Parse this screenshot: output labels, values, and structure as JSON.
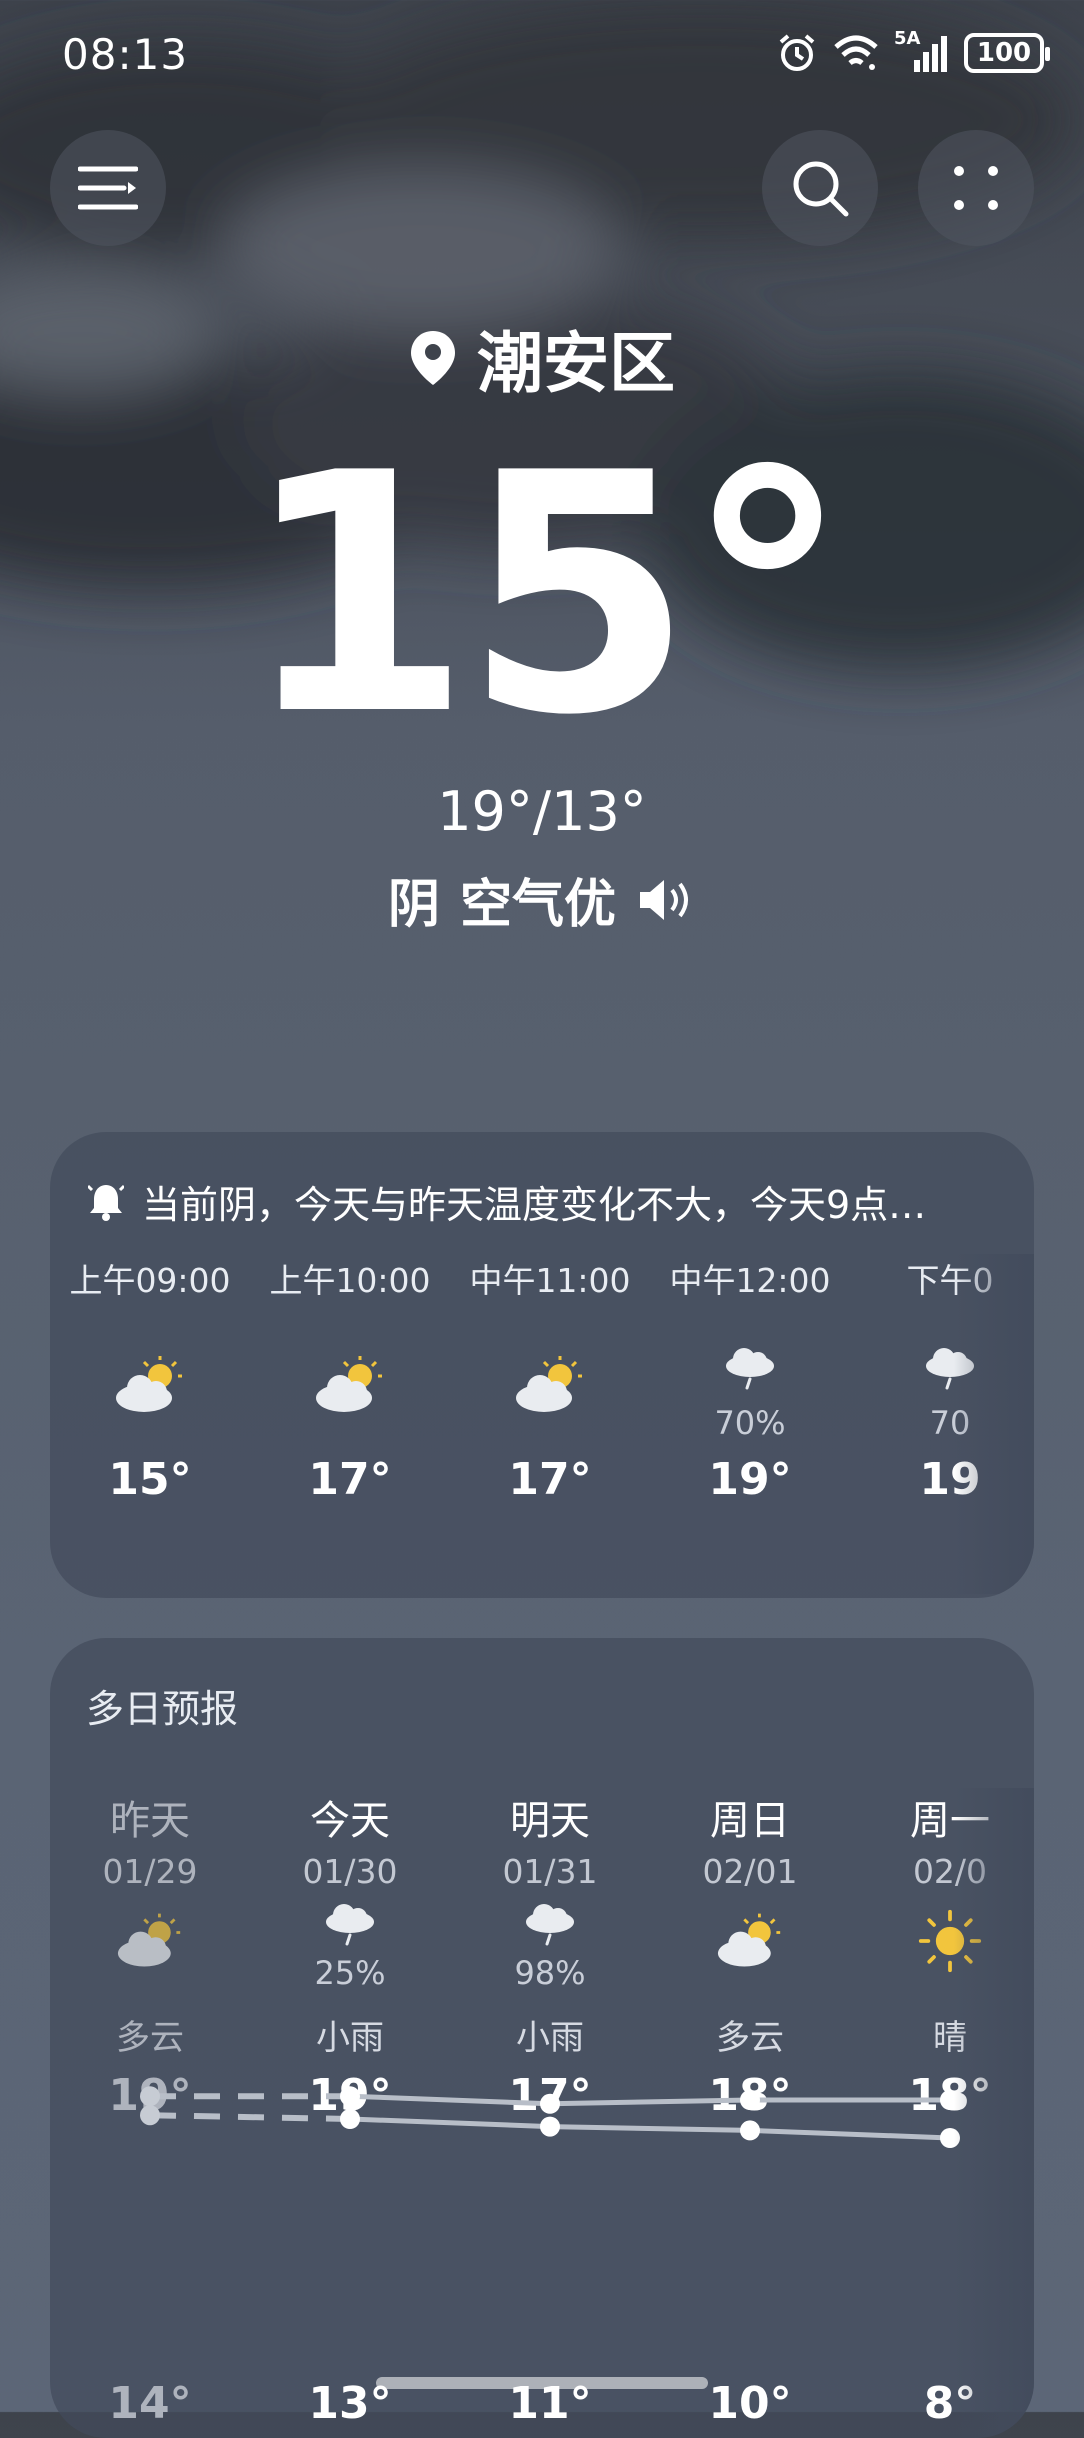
{
  "status_bar": {
    "time": "08:13",
    "network": "5A",
    "battery": "100"
  },
  "location": "潮安区",
  "current_temp": "15°",
  "high_low": "19°/13°",
  "condition": "阴",
  "air_quality": "空气优",
  "alert_text": "当前阴，今天与昨天温度变化不大，今天9点…",
  "hourly": [
    {
      "time": "上午09:00",
      "icon": "partly-cloudy-icon",
      "precip": "",
      "temp": "15°"
    },
    {
      "time": "上午10:00",
      "icon": "partly-cloudy-icon",
      "precip": "",
      "temp": "17°"
    },
    {
      "time": "中午11:00",
      "icon": "partly-cloudy-icon",
      "precip": "",
      "temp": "17°"
    },
    {
      "time": "中午12:00",
      "icon": "light-rain-icon",
      "precip": "70%",
      "temp": "19°"
    },
    {
      "time": "下午0",
      "icon": "light-rain-icon",
      "precip": "70",
      "temp": "19"
    }
  ],
  "daily_title": "多日预报",
  "daily": [
    {
      "day": "昨天",
      "date": "01/29",
      "icon": "partly-cloudy-icon",
      "precip": "",
      "weather": "多云",
      "high": "19°",
      "low": "14°"
    },
    {
      "day": "今天",
      "date": "01/30",
      "icon": "light-rain-icon",
      "precip": "25%",
      "weather": "小雨",
      "high": "19°",
      "low": "13°"
    },
    {
      "day": "明天",
      "date": "01/31",
      "icon": "light-rain-icon",
      "precip": "98%",
      "weather": "小雨",
      "high": "17°",
      "low": "11°"
    },
    {
      "day": "周日",
      "date": "02/01",
      "icon": "partly-cloudy-icon",
      "precip": "",
      "weather": "多云",
      "high": "18°",
      "low": "10°"
    },
    {
      "day": "周一",
      "date": "02/0",
      "icon": "sunny-icon",
      "precip": "",
      "weather": "晴",
      "high": "18°",
      "low": "8°"
    }
  ],
  "colors": {
    "sun": "#f2c53d",
    "cloud": "#e9ecf0",
    "card": "#424b5c",
    "line": "#b8bec8"
  }
}
